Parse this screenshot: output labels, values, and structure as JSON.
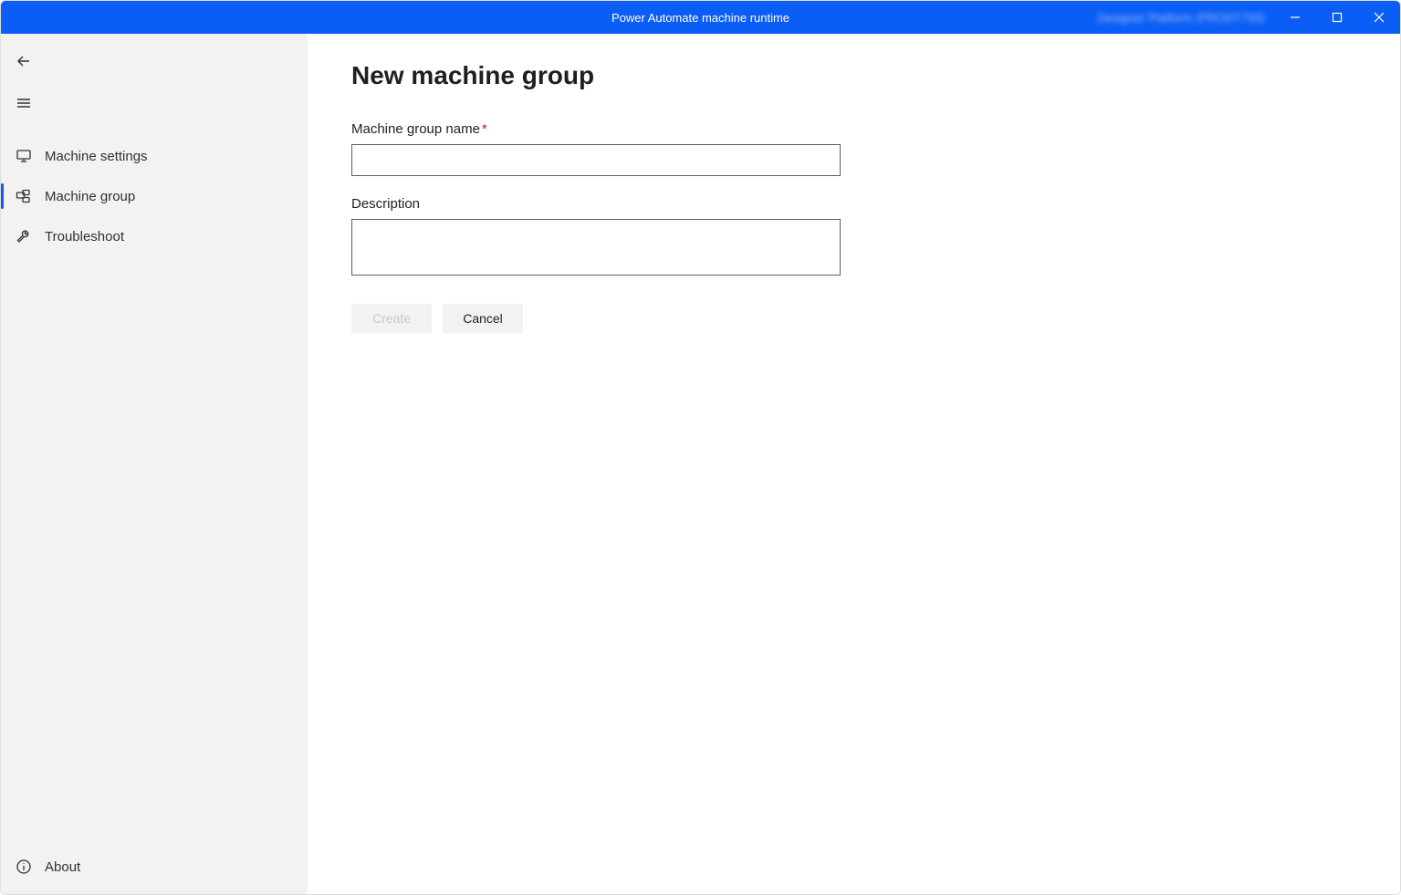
{
  "window": {
    "title": "Power Automate machine runtime",
    "user": "Designer Platform (PRODT700)"
  },
  "sidebar": {
    "items": [
      {
        "label": "Machine settings"
      },
      {
        "label": "Machine group"
      },
      {
        "label": "Troubleshoot"
      }
    ],
    "footer": {
      "label": "About"
    }
  },
  "main": {
    "title": "New machine group",
    "name_label": "Machine group name",
    "name_value": "",
    "desc_label": "Description",
    "desc_value": "",
    "create_label": "Create",
    "cancel_label": "Cancel"
  }
}
